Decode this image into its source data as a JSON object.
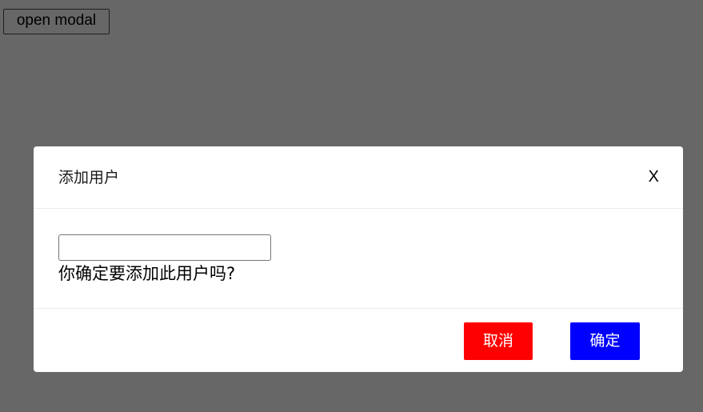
{
  "page": {
    "open_button_label": "open modal"
  },
  "modal": {
    "title": "添加用户",
    "close_label": "X",
    "input_value": "",
    "message": "你确定要添加此用户吗?",
    "cancel_label": "取消",
    "confirm_label": "确定"
  },
  "colors": {
    "overlay": "#676767",
    "cancel": "#ff0000",
    "confirm": "#0000ff"
  }
}
